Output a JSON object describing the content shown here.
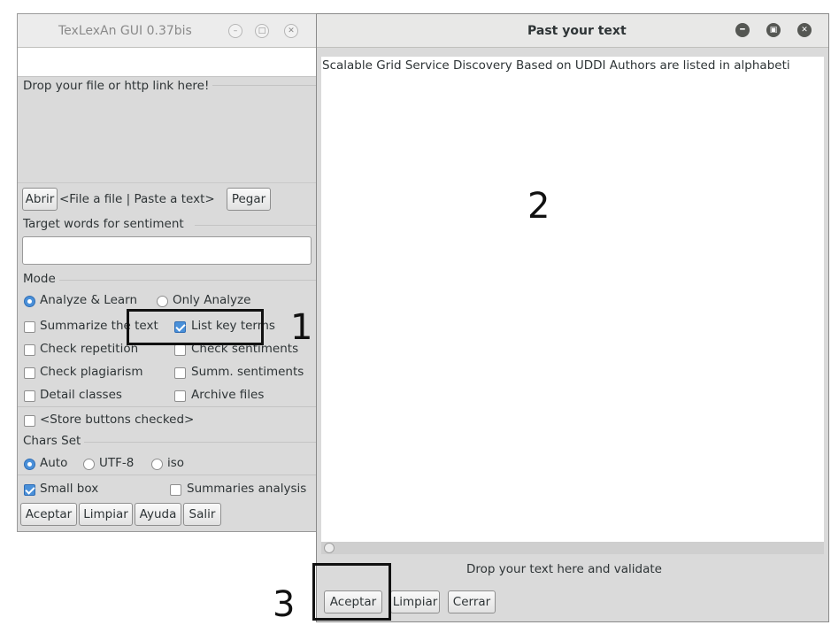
{
  "left_window": {
    "title": "TexLexAn GUI 0.37bis",
    "drop_zone_label": "Drop your file or http link here!",
    "open_button": "Abrir",
    "file_hint": "<File a file | Paste a text>",
    "paste_button": "Pegar",
    "target_words_label": "Target words for sentiment",
    "target_words_value": "",
    "mode": {
      "label": "Mode",
      "analyze_learn": "Analyze & Learn",
      "only_analyze": "Only Analyze",
      "selected": "Analyze & Learn"
    },
    "options": {
      "summarize": {
        "label": "Summarize the text",
        "checked": false
      },
      "list_key_terms": {
        "label": "List key terms",
        "checked": true
      },
      "check_repetition": {
        "label": "Check repetition",
        "checked": false
      },
      "check_sentiments": {
        "label": "Check sentiments",
        "checked": false
      },
      "check_plagiarism": {
        "label": "Check plagiarism",
        "checked": false
      },
      "summ_sentiments": {
        "label": "Summ. sentiments",
        "checked": false
      },
      "detail_classes": {
        "label": "Detail classes",
        "checked": false
      },
      "archive_files": {
        "label": "Archive files",
        "checked": false
      },
      "store_buttons": {
        "label": "<Store buttons checked>",
        "checked": false
      }
    },
    "chars_set": {
      "label": "Chars Set",
      "auto": "Auto",
      "utf8": "UTF-8",
      "iso": "iso",
      "selected": "Auto"
    },
    "small_box": {
      "label": "Small box",
      "checked": true
    },
    "summaries_analysis": {
      "label": "Summaries analysis",
      "checked": false
    },
    "buttons": {
      "accept": "Aceptar",
      "clear": "Limpiar",
      "help": "Ayuda",
      "exit": "Salir"
    }
  },
  "right_window": {
    "title": "Past your text",
    "text_content": "Scalable Grid Service Discovery Based on UDDI Authors are listed in alphabeti",
    "status": "Drop your text here and validate",
    "buttons": {
      "accept": "Aceptar",
      "clear": "Limpiar",
      "close": "Cerrar"
    }
  },
  "annotations": {
    "one": "1",
    "two": "2",
    "three": "3"
  },
  "icons": {
    "minimize": "minimize-icon",
    "maximize": "maximize-icon",
    "close": "close-icon"
  },
  "colors": {
    "accent": "#4a90d9",
    "window_bg": "#dadada",
    "titlebar_bg": "#e8e8e7",
    "dark_controls": "#555753"
  }
}
